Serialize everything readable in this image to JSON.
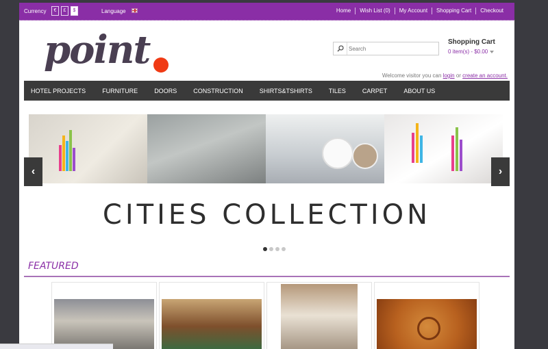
{
  "topbar": {
    "currency_label": "Currency",
    "currencies": [
      "€",
      "£",
      "$"
    ],
    "language_label": "Language",
    "links": [
      "Home",
      "Wish List (0)",
      "My Account",
      "Shopping Cart",
      "Checkout"
    ]
  },
  "header": {
    "logo_text": "point",
    "search_placeholder": "Search",
    "cart_title": "Shopping Cart",
    "cart_summary": "0 item(s) - $0.00",
    "welcome_prefix": "Welcome visitor you can",
    "login_link": "login",
    "welcome_or": "or",
    "create_link": "create an account."
  },
  "nav": {
    "items": [
      "HOTEL PROJECTS",
      "FURNITURE",
      "DOORS",
      "CONSTRUCTION",
      "SHIRTS&TSHIRTS",
      "TILES",
      "CARPET",
      "ABOUT US"
    ]
  },
  "slider": {
    "caption": "CITIES COLLECTION",
    "prev": "‹",
    "next": "›",
    "active_index": 0,
    "slide_count": 4
  },
  "featured": {
    "title": "FEATURED"
  },
  "colors": {
    "brand_purple": "#8a2ea6",
    "nav_dark": "#3a3a3a",
    "logo_dot": "#f03a14"
  }
}
